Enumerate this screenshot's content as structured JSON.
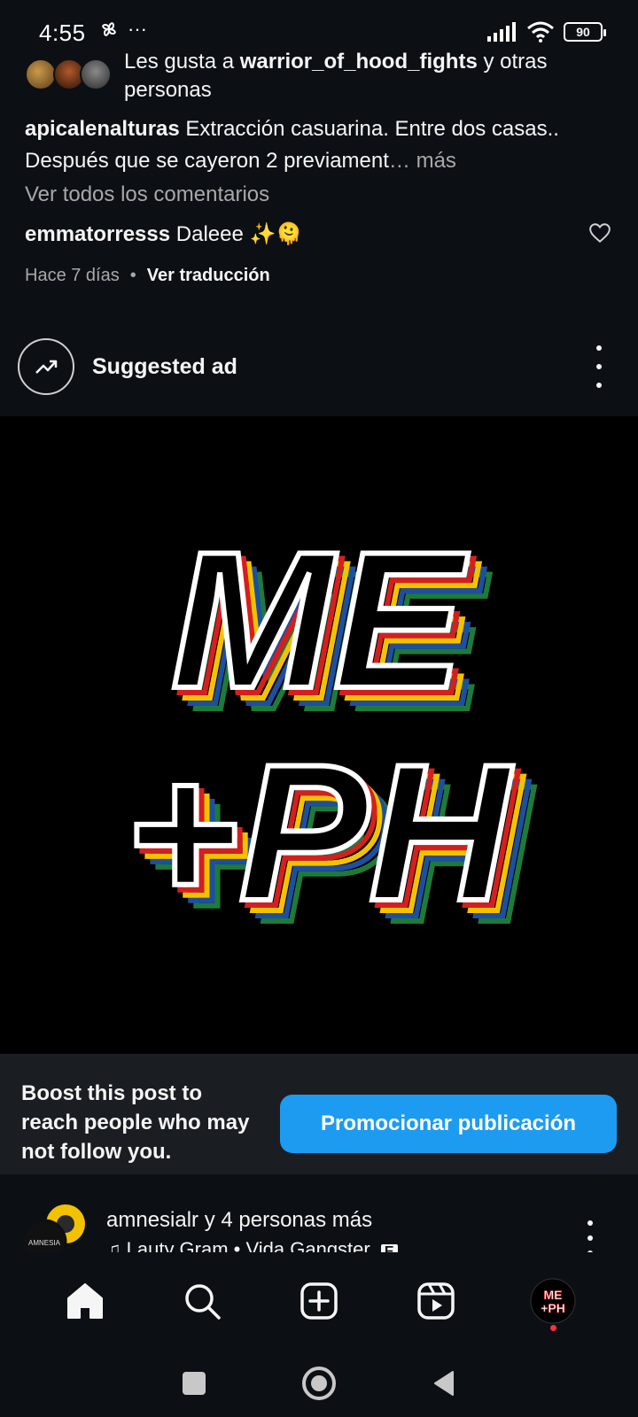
{
  "status_bar": {
    "time": "4:55",
    "dots": "···",
    "battery": "90"
  },
  "likes": {
    "prefix": "Les gusta a ",
    "user": "warrior_of_hood_fights",
    "suffix": " y otras personas"
  },
  "caption": {
    "user": "apicalenalturas",
    "text": " Extracción casuarina. Entre dos casas.. Después que se cayeron 2 previament",
    "ellipsis": "…",
    "more": " más"
  },
  "view_comments": "Ver todos los comentarios",
  "comment": {
    "user": "emmatorresss",
    "text": " Daleee ✨🫠"
  },
  "meta": {
    "time_ago": "Hace 7 días",
    "separator": "•",
    "translate": "Ver traducción"
  },
  "ad": {
    "title": "Suggested ad",
    "art_line1": "ME",
    "art_line2": "+PH"
  },
  "boost": {
    "text": "Boost this post to reach people who may not follow you.",
    "button": "Promocionar publicación"
  },
  "next_post": {
    "user_line": "amnesialr y 4 personas más",
    "music_line": "Lauty Gram • Vida Gangster",
    "explicit": "E",
    "avatar_label": "AMNESIA"
  },
  "nav": {
    "profile_label": "ME\n+PH"
  },
  "colors": {
    "background": "#0c1014",
    "accent": "#1d9bf0",
    "notification": "#ff3040"
  }
}
